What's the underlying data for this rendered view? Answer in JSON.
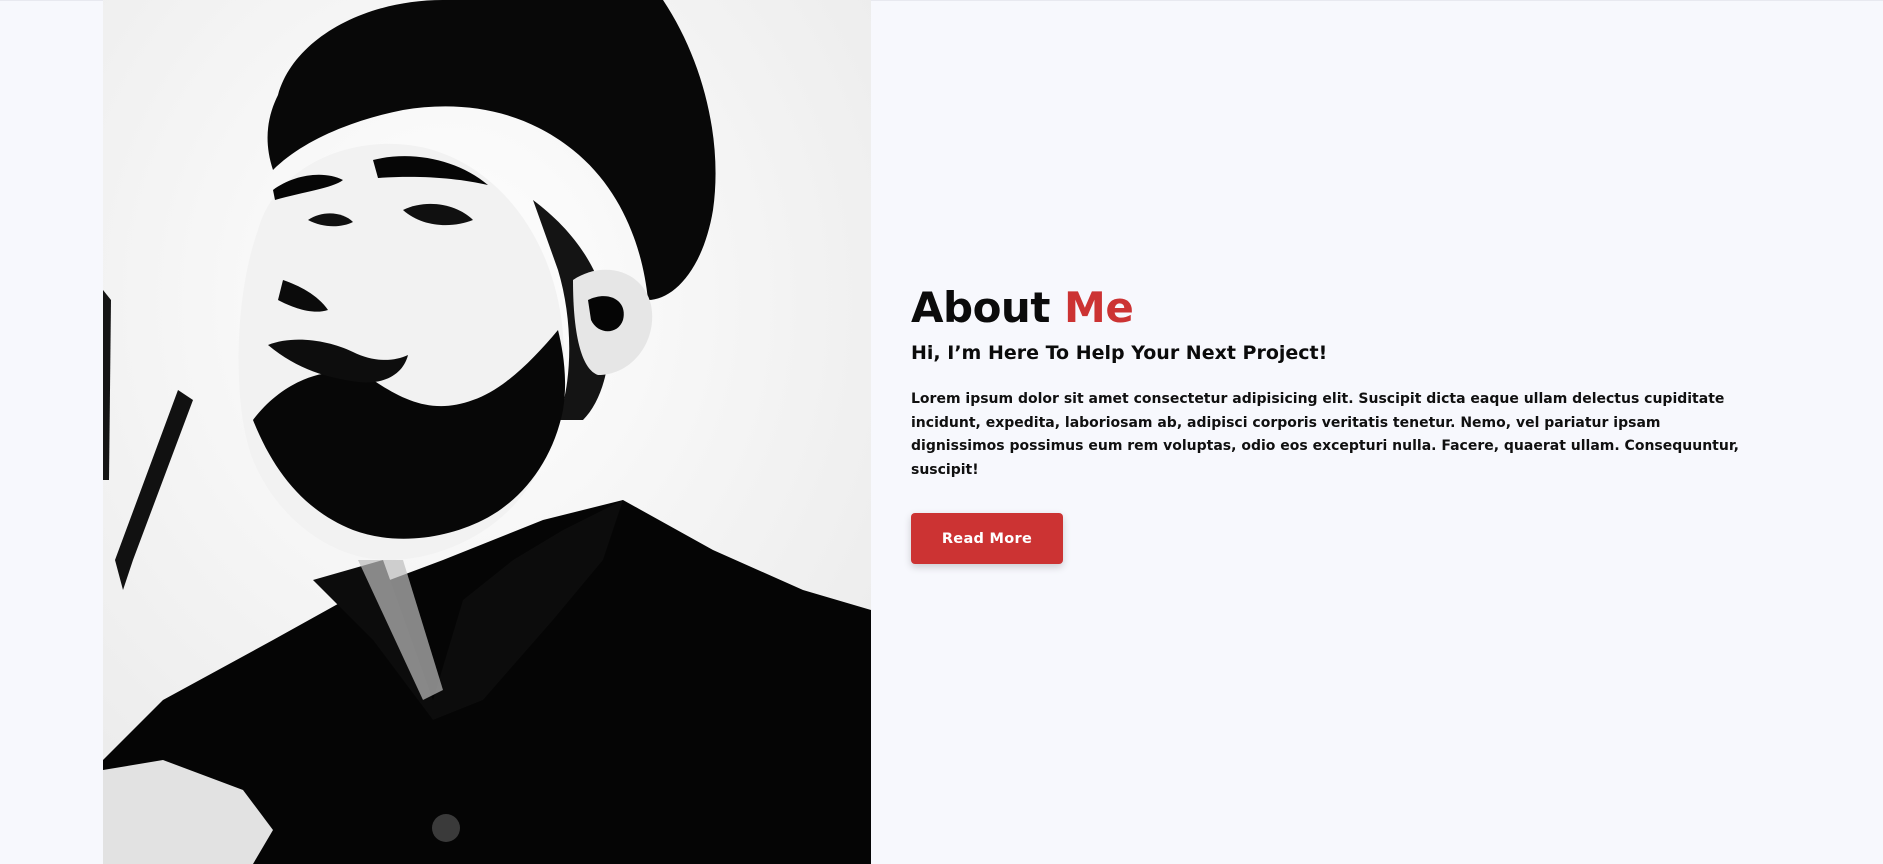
{
  "about": {
    "title_main": "About",
    "title_accent": "Me",
    "subtitle": "Hi, I’m Here To Help Your Next Project!",
    "body": "Lorem ipsum dolor sit amet consectetur adipisicing elit. Suscipit dicta eaque ullam delectus cupiditate incidunt, expedita, laboriosam ab, adipisci corporis veritatis tenetur. Nemo, vel pariatur ipsam dignissimos possimus eum rem voluptas, odio eos excepturi nulla. Facere, quaerat ullam. Consequuntur, suscipit!",
    "button_label": "Read More"
  },
  "photo": {
    "image": "black-and-white-portrait-bearded-man"
  },
  "colors": {
    "accent": "#cc3333",
    "background": "#f7f8fd",
    "text": "#0b0b0b"
  }
}
